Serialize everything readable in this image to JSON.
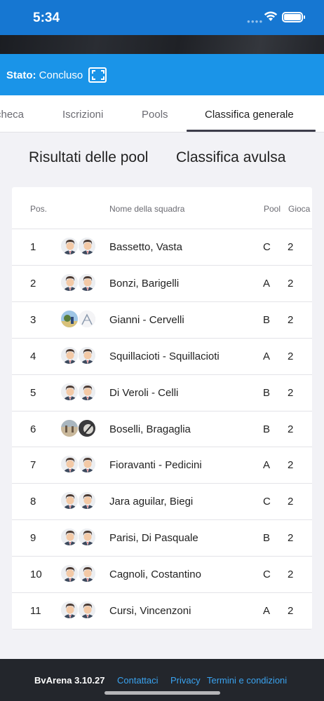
{
  "status_bar": {
    "time": "5:34"
  },
  "state": {
    "label": "Stato:",
    "value": "Concluso"
  },
  "tabs": [
    {
      "label": "checa",
      "active": false
    },
    {
      "label": "Iscrizioni",
      "active": false
    },
    {
      "label": "Pools",
      "active": false
    },
    {
      "label": "Classifica generale",
      "active": true
    }
  ],
  "segments": {
    "pool_results": "Risultati delle pool",
    "split_ranking": "Classifica avulsa"
  },
  "table": {
    "headers": {
      "pos": "Pos.",
      "team": "Nome della squadra",
      "pool": "Pool",
      "played": "Gioca"
    },
    "rows": [
      {
        "pos": "1",
        "team": "Bassetto, Vasta",
        "pool": "C",
        "played": "2",
        "avatars": [
          "default",
          "default"
        ]
      },
      {
        "pos": "2",
        "team": "Bonzi, Barigelli",
        "pool": "A",
        "played": "2",
        "avatars": [
          "default",
          "default"
        ]
      },
      {
        "pos": "3",
        "team": "Gianni - Cervelli",
        "pool": "B",
        "played": "2",
        "avatars": [
          "photo-beach",
          "photo-sketch"
        ]
      },
      {
        "pos": "4",
        "team": "Squillacioti - Squillacioti",
        "pool": "A",
        "played": "2",
        "avatars": [
          "default",
          "default"
        ]
      },
      {
        "pos": "5",
        "team": "Di Veroli - Celli",
        "pool": "B",
        "played": "2",
        "avatars": [
          "default",
          "default"
        ]
      },
      {
        "pos": "6",
        "team": "Boselli, Bragaglia",
        "pool": "B",
        "played": "2",
        "avatars": [
          "photo-sand",
          "photo-dark"
        ]
      },
      {
        "pos": "7",
        "team": "Fioravanti - Pedicini",
        "pool": "A",
        "played": "2",
        "avatars": [
          "default",
          "default"
        ]
      },
      {
        "pos": "8",
        "team": "Jara aguilar, Biegi",
        "pool": "C",
        "played": "2",
        "avatars": [
          "default",
          "default"
        ]
      },
      {
        "pos": "9",
        "team": "Parisi, Di Pasquale",
        "pool": "B",
        "played": "2",
        "avatars": [
          "default",
          "default"
        ]
      },
      {
        "pos": "10",
        "team": "Cagnoli, Costantino",
        "pool": "C",
        "played": "2",
        "avatars": [
          "default",
          "default"
        ]
      },
      {
        "pos": "11",
        "team": "Cursi, Vincenzoni",
        "pool": "A",
        "played": "2",
        "avatars": [
          "default",
          "default"
        ]
      }
    ]
  },
  "footer": {
    "brand": "BvArena 3.10.27",
    "links": [
      "Contattaci",
      "Privacy",
      "Termini e condizioni"
    ]
  },
  "colors": {
    "status_bar": "#1677d2",
    "state_bar": "#1a94e8",
    "footer_bg": "#23262c",
    "link": "#3aa3f0"
  }
}
